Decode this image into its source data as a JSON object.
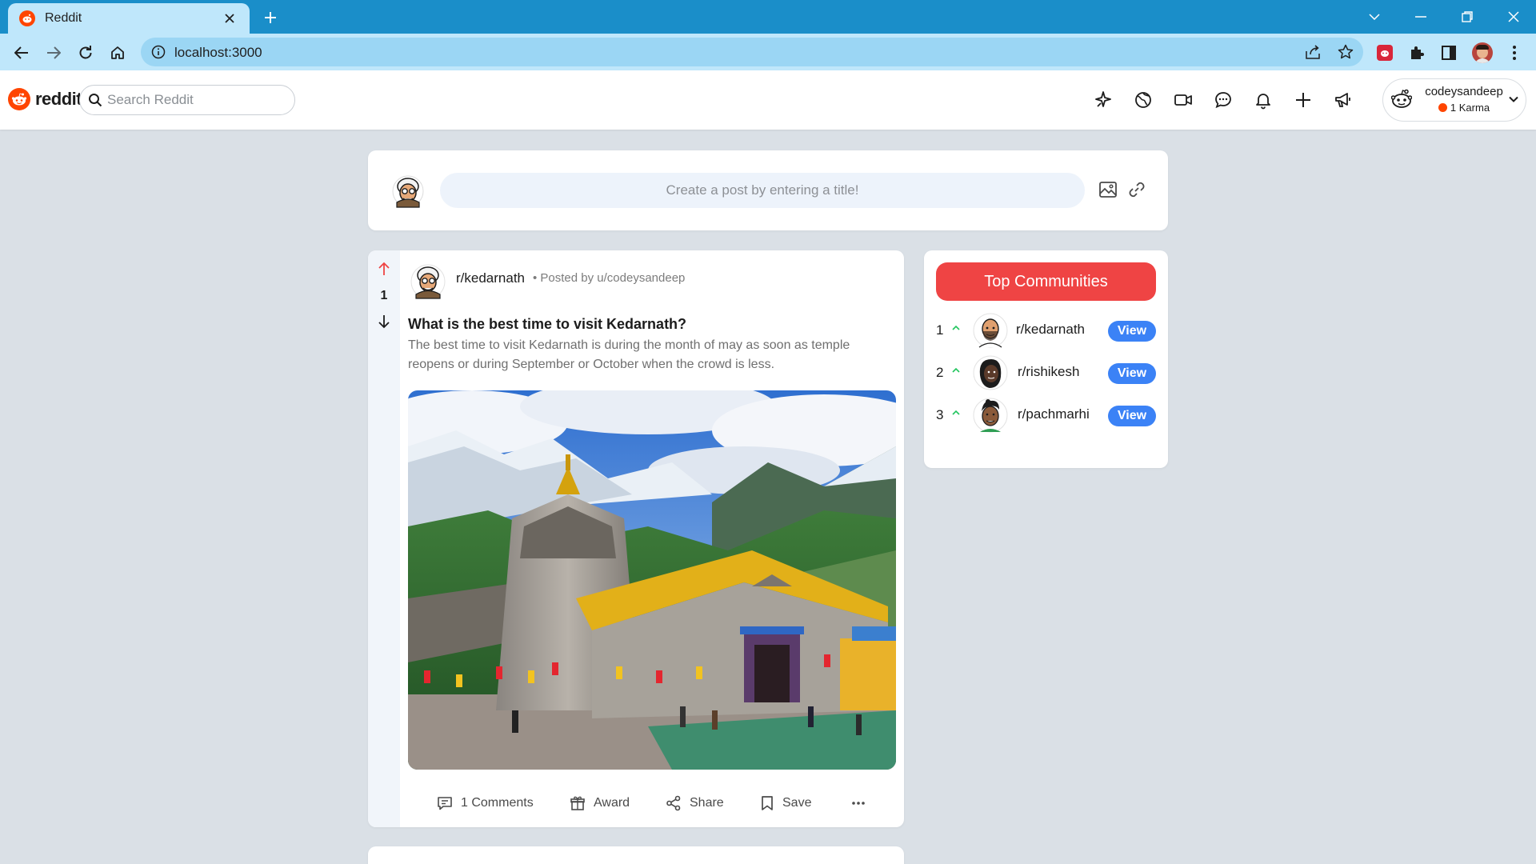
{
  "browser": {
    "tab_title": "Reddit",
    "url": "localhost:3000"
  },
  "header": {
    "logo_text": "reddit",
    "search_placeholder": "Search Reddit",
    "user": {
      "name": "codeysandeep",
      "karma": "1 Karma"
    }
  },
  "create_post": {
    "placeholder": "Create a post by entering a title!"
  },
  "post": {
    "votes": "1",
    "subreddit": "r/kedarnath",
    "meta": "• Posted by u/codeysandeep",
    "title": "What is the best time to visit Kedarnath?",
    "body": "The best time to visit Kedarnath is during the month of may as soon as temple reopens or during September or October when the crowd is less.",
    "actions": {
      "comments": "1 Comments",
      "award": "Award",
      "share": "Share",
      "save": "Save"
    }
  },
  "top_communities": {
    "title": "Top Communities",
    "items": [
      {
        "rank": "1",
        "name": "r/kedarnath",
        "action": "View"
      },
      {
        "rank": "2",
        "name": "r/rishikesh",
        "action": "View"
      },
      {
        "rank": "3",
        "name": "r/pachmarhi",
        "action": "View"
      }
    ]
  },
  "colors": {
    "reddit_orange": "#ff4500",
    "top_communities_red": "#ef4444",
    "view_button_blue": "#3b82f6",
    "page_background": "#dae0e6"
  },
  "icons": [
    "reddit-favicon",
    "close-icon",
    "plus-icon",
    "chevron-down-icon",
    "minimize-icon",
    "restore-icon",
    "back-icon",
    "forward-icon",
    "reload-icon",
    "home-icon",
    "info-icon",
    "share-icon",
    "star-icon",
    "puzzle-icon",
    "sidepanel-icon",
    "kebab-icon",
    "search-icon",
    "sparkle-icon",
    "globe-icon",
    "video-icon",
    "chat-icon",
    "bell-icon",
    "megaphone-icon",
    "image-icon",
    "link-icon",
    "arrow-up-icon",
    "arrow-down-icon",
    "comment-icon",
    "gift-icon",
    "save-icon",
    "more-icon"
  ]
}
